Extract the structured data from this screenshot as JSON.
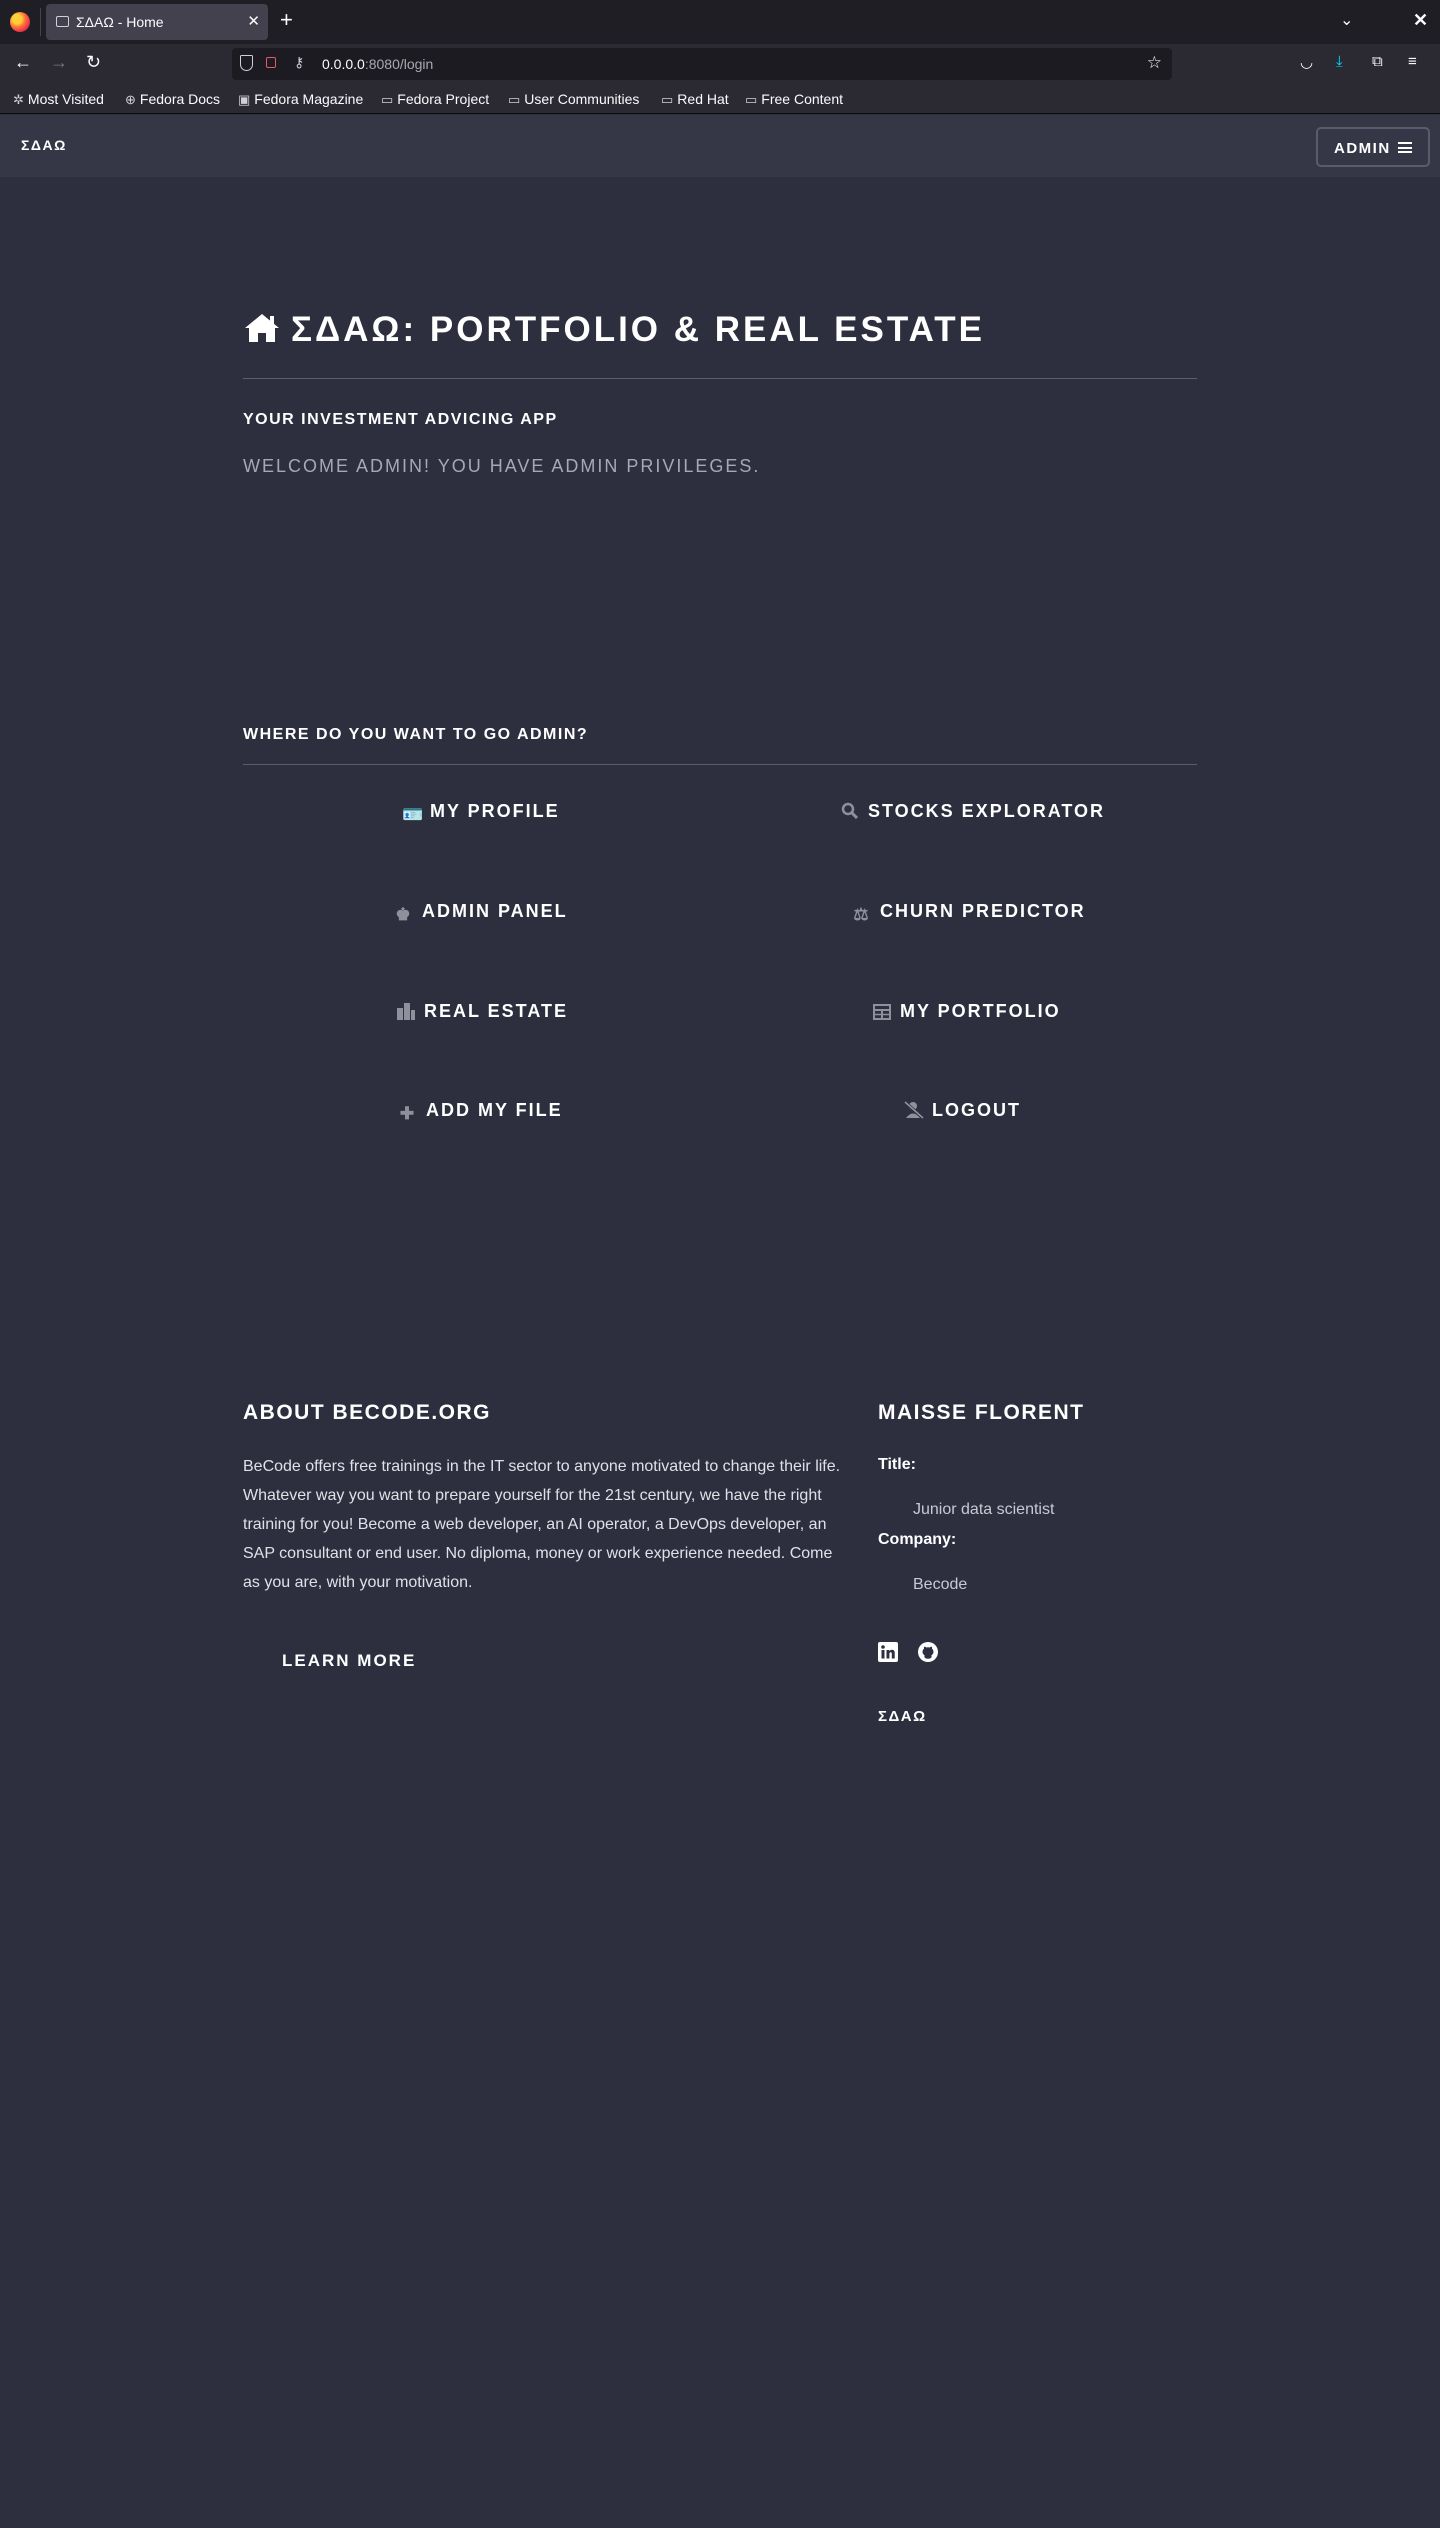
{
  "browser": {
    "tab_title": "ΣΔΑΩ - Home",
    "tab_close": "✕",
    "new_tab": "+",
    "url_host": "0.0.0.0",
    "url_rest": ":8080/login",
    "bookmarks": [
      "Most Visited",
      "Fedora Docs",
      "Fedora Magazine",
      "Fedora Project",
      "User Communities",
      "Red Hat",
      "Free Content"
    ]
  },
  "header": {
    "brand": "ΣΔΑΩ",
    "menu_label": "ADMIN"
  },
  "hero": {
    "title": "ΣΔΑΩ: PORTFOLIO & REAL ESTATE",
    "subtitle": "YOUR INVESTMENT ADVICING APP",
    "welcome": "WELCOME ADMIN! YOU HAVE ADMIN PRIVILEGES."
  },
  "navigation": {
    "title": "WHERE DO YOU WANT TO GO ADMIN?",
    "links": [
      {
        "label": "MY PROFILE",
        "icon": "id-card-icon"
      },
      {
        "label": "STOCKS EXPLORATOR",
        "icon": "search-icon"
      },
      {
        "label": "ADMIN PANEL",
        "icon": "crown-icon"
      },
      {
        "label": "CHURN PREDICTOR",
        "icon": "user-scale-icon"
      },
      {
        "label": "REAL ESTATE",
        "icon": "city-icon"
      },
      {
        "label": "MY PORTFOLIO",
        "icon": "table-icon"
      },
      {
        "label": "ADD MY FILE",
        "icon": "plus-icon"
      },
      {
        "label": "LOGOUT",
        "icon": "user-slash-icon"
      }
    ]
  },
  "footer": {
    "about_title": "ABOUT BECODE.ORG",
    "about_text": "BeCode offers free trainings in the IT sector to anyone motivated to change their life. Whatever way you want to prepare yourself for the 21st century, we have the right training for you! Become a web developer, an AI operator, a DevOps developer, an SAP consultant or end user. No diploma, money or work experience needed. Come as you are, with your motivation.",
    "learn_more": "LEARN MORE",
    "author_name": "MAISSE FLORENT",
    "title_label": "Title:",
    "title_value": "Junior data scientist",
    "company_label": "Company:",
    "company_value": "Becode",
    "brand": "ΣΔΑΩ"
  },
  "colors": {
    "page_bg": "#2d2f3f",
    "header_bg": "#353747",
    "muted_text": "#a6a8b6"
  }
}
